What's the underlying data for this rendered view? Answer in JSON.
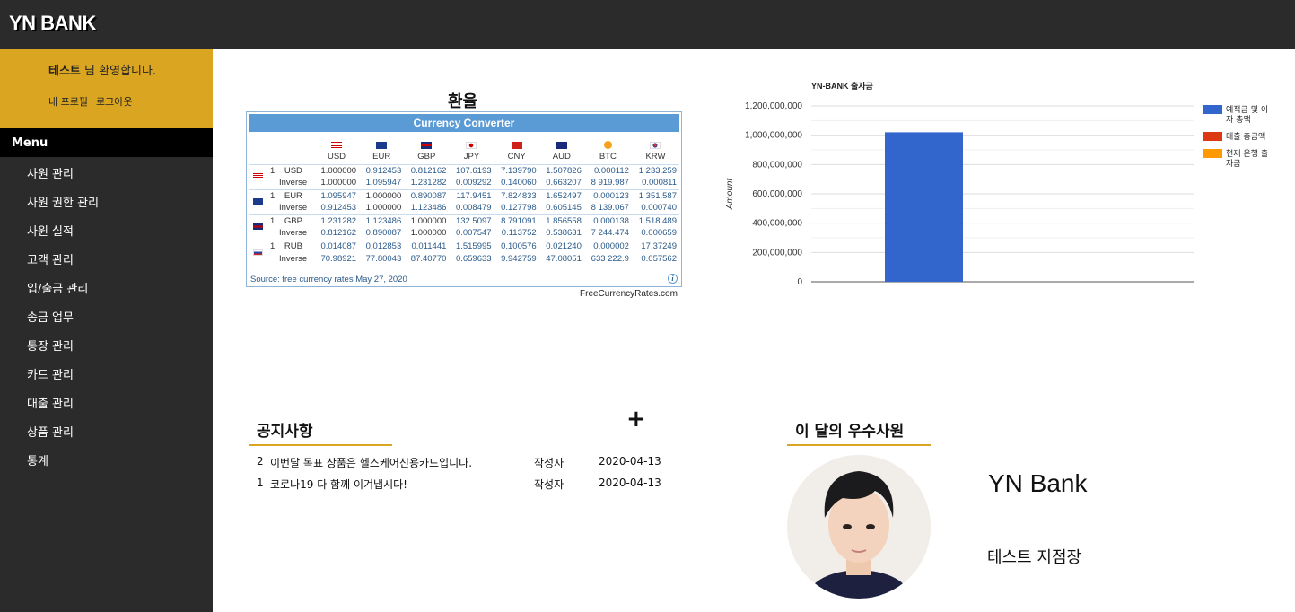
{
  "app": {
    "logo": "YN BANK"
  },
  "sidebar": {
    "welcome_name": "테스트",
    "welcome_suffix": " 님 환영합니다.",
    "profile_link": "내 프로필",
    "logout_link": "로그아웃",
    "menu_title": "Menu",
    "items": [
      {
        "label": "사원 관리"
      },
      {
        "label": "사원 권한 관리"
      },
      {
        "label": "사원 실적"
      },
      {
        "label": "고객 관리"
      },
      {
        "label": "입/출금 관리"
      },
      {
        "label": "송금 업무"
      },
      {
        "label": "통장 관리"
      },
      {
        "label": "카드 관리"
      },
      {
        "label": "대출 관리"
      },
      {
        "label": "상품 관리"
      },
      {
        "label": "통계"
      }
    ]
  },
  "exchange": {
    "title": "환율",
    "widget_title": "Currency Converter",
    "currencies": [
      "USD",
      "EUR",
      "GBP",
      "JPY",
      "CNY",
      "AUD",
      "BTC",
      "KRW"
    ],
    "rows": [
      {
        "amount": "1",
        "code": "USD",
        "rate": [
          "1.000000",
          "0.912453",
          "0.812162",
          "107.6193",
          "7.139790",
          "1.507826",
          "0.000112",
          "1 233.259"
        ],
        "inverse_label": "Inverse",
        "inverse": [
          "1.000000",
          "1.095947",
          "1.231282",
          "0.009292",
          "0.140060",
          "0.663207",
          "8 919.987",
          "0.000811"
        ]
      },
      {
        "amount": "1",
        "code": "EUR",
        "rate": [
          "1.095947",
          "1.000000",
          "0.890087",
          "117.9451",
          "7.824833",
          "1.652497",
          "0.000123",
          "1 351.587"
        ],
        "inverse_label": "Inverse",
        "inverse": [
          "0.912453",
          "1.000000",
          "1.123486",
          "0.008479",
          "0.127798",
          "0.605145",
          "8 139.067",
          "0.000740"
        ]
      },
      {
        "amount": "1",
        "code": "GBP",
        "rate": [
          "1.231282",
          "1.123486",
          "1.000000",
          "132.5097",
          "8.791091",
          "1.856558",
          "0.000138",
          "1 518.489"
        ],
        "inverse_label": "Inverse",
        "inverse": [
          "0.812162",
          "0.890087",
          "1.000000",
          "0.007547",
          "0.113752",
          "0.538631",
          "7 244.474",
          "0.000659"
        ]
      },
      {
        "amount": "1",
        "code": "RUB",
        "rate": [
          "0.014087",
          "0.012853",
          "0.011441",
          "1.515995",
          "0.100576",
          "0.021240",
          "0.000002",
          "17.37249"
        ],
        "inverse_label": "Inverse",
        "inverse": [
          "70.98921",
          "77.80043",
          "87.40770",
          "0.659633",
          "9.942759",
          "47.08051",
          "633 222.9",
          "0.057562"
        ]
      }
    ],
    "source": "Source: free currency rates   May 27, 2020",
    "info_icon": "i",
    "credit": "FreeCurrencyRates.com"
  },
  "chart_data": {
    "type": "bar",
    "title": "YN-BANK 출자금",
    "ylabel": "Amount",
    "xlabel": "",
    "ylim": [
      0,
      1200000000
    ],
    "yticks": [
      "0",
      "200,000,000",
      "400,000,000",
      "600,000,000",
      "800,000,000",
      "1,000,000,000",
      "1,200,000,000"
    ],
    "series": [
      {
        "name": "예적금 및 이자 총액",
        "value": 1020000000,
        "color": "#3366cc"
      },
      {
        "name": "대출 총금액",
        "value": 0,
        "color": "#dc3912"
      },
      {
        "name": "현재 은행 출자금",
        "value": 0,
        "color": "#ff9900"
      }
    ],
    "legend_position": "right"
  },
  "chart_legend_lines": [
    [
      "예적금 및 이",
      "자 총액"
    ],
    [
      "대출 총금액"
    ],
    [
      "현재 은행 출",
      "자금"
    ]
  ],
  "notice": {
    "title": "공지사항",
    "add_icon": "+",
    "rows": [
      {
        "num": "2",
        "title": "이번달 목표 상품은 헬스케어신용카드입니다.",
        "writer": "작성자",
        "date": "2020-04-13"
      },
      {
        "num": "1",
        "title": "코로나19 다 함께 이겨냅시다!",
        "writer": "작성자",
        "date": "2020-04-13"
      }
    ]
  },
  "employee": {
    "title": "이 달의 우수사원",
    "bank": "YN Bank",
    "name": "테스트 지점장"
  }
}
